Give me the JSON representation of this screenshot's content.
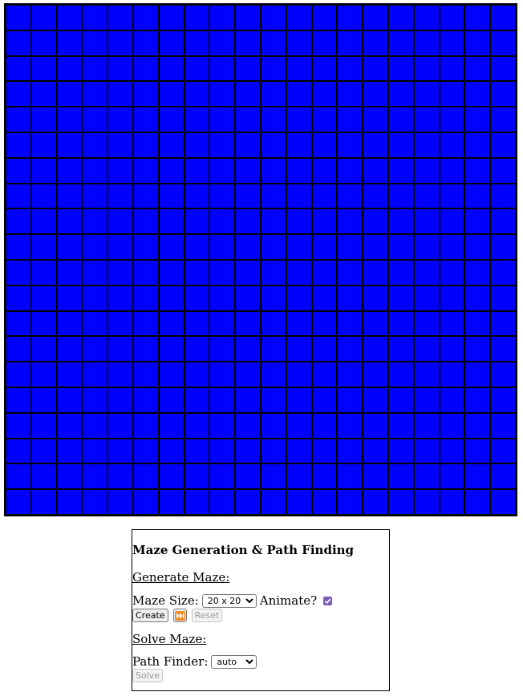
{
  "maze": {
    "rows": 20,
    "cols": 20,
    "cell_color": "#0000ff",
    "wall_color": "#000000"
  },
  "panel": {
    "title": "Maze Generation & Path Finding",
    "generate_heading": "Generate Maze:",
    "maze_size_label": "Maze Size:",
    "maze_size_value": "20 x 20",
    "animate_label": "Animate?",
    "animate_checked": true,
    "create_button": "Create",
    "fast_forward_icon": "fast-forward-icon",
    "reset_button": "Reset",
    "solve_heading": "Solve Maze:",
    "path_finder_label": "Path Finder:",
    "path_finder_value": "auto",
    "solve_button": "Solve"
  }
}
